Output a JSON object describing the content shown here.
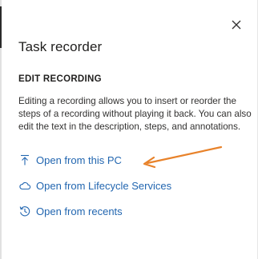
{
  "panel": {
    "title": "Task recorder",
    "close_label": "Close"
  },
  "edit_section": {
    "heading": "EDIT RECORDING",
    "description": "Editing a recording allows you to insert or reorder the steps of a recording without playing it back. You can also edit the text in the description, steps, and annotations."
  },
  "actions": [
    {
      "label": "Open from this PC",
      "icon": "upload-icon"
    },
    {
      "label": "Open from Lifecycle Services",
      "icon": "cloud-icon"
    },
    {
      "label": "Open from recents",
      "icon": "history-icon"
    }
  ],
  "colors": {
    "link": "#2266b0",
    "annotation_arrow": "#e8822a",
    "text": "#201f1e"
  }
}
